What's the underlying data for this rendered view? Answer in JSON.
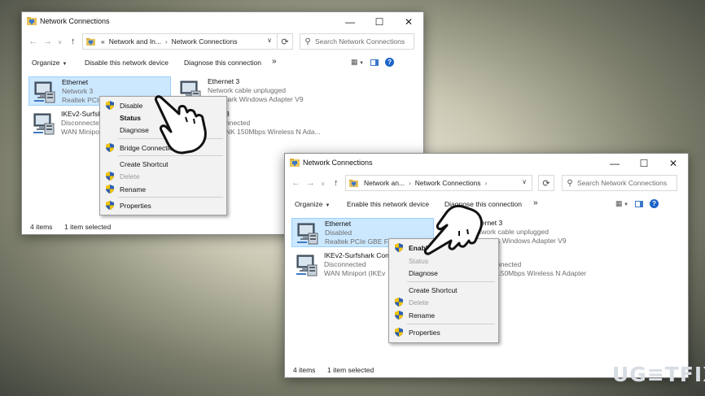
{
  "window1": {
    "title": "Network Connections",
    "controls": {
      "minimize": "—",
      "maximize": "☐",
      "close": "✕"
    },
    "address": {
      "overflow": "«",
      "crumbs": [
        "Network and In...",
        "Network Connections"
      ]
    },
    "search_placeholder": "Search Network Connections",
    "toolbar": {
      "organize": "Organize",
      "action1": "Disable this network device",
      "action2": "Diagnose this connection",
      "more": "»"
    },
    "items": [
      {
        "name": "Ethernet",
        "line2": "Network 3",
        "line3": "Realtek PCIe",
        "selected": true
      },
      {
        "name": "Ethernet 3",
        "line2": "Network cable unplugged",
        "line3": "Surfshark Windows Adapter V9",
        "selected": false
      },
      {
        "name": "IKEv2-Surfshark",
        "line2": "Disconnected",
        "line3": "WAN Miniport",
        "selected": false
      },
      {
        "name": "3",
        "line2": "nnected",
        "line3": "NK 150Mbps Wireless N Ada...",
        "selected": false
      }
    ],
    "context_menu": [
      {
        "label": "Disable",
        "shield": true,
        "bold": false,
        "disabled": false
      },
      {
        "label": "Status",
        "shield": false,
        "bold": true,
        "disabled": false
      },
      {
        "label": "Diagnose",
        "shield": false,
        "bold": false,
        "disabled": false
      },
      {
        "label": "Bridge Connections",
        "shield": true,
        "bold": false,
        "disabled": false
      },
      {
        "label": "Create Shortcut",
        "shield": false,
        "bold": false,
        "disabled": false
      },
      {
        "label": "Delete",
        "shield": true,
        "bold": false,
        "disabled": true
      },
      {
        "label": "Rename",
        "shield": true,
        "bold": false,
        "disabled": false
      },
      {
        "label": "Properties",
        "shield": true,
        "bold": false,
        "disabled": false
      }
    ],
    "status": {
      "count": "4 items",
      "selected": "1 item selected"
    }
  },
  "window2": {
    "title": "Network Connections",
    "controls": {
      "minimize": "—",
      "maximize": "☐",
      "close": "✕"
    },
    "address": {
      "crumbs": [
        "Network an...",
        "Network Connections"
      ],
      "trail": "›"
    },
    "search_placeholder": "Search Network Connections",
    "toolbar": {
      "organize": "Organize",
      "action1": "Enable this network device",
      "action2": "Diagnose this connection",
      "more": "»"
    },
    "items": [
      {
        "name": "Ethernet",
        "line2": "Disabled",
        "line3": "Realtek PCIe GBE Fam",
        "selected": true
      },
      {
        "name": "Ethernet 3",
        "line2": "Network cable unplugged",
        "line3": "Surfshark Windows Adapter V9",
        "selected": false
      },
      {
        "name": "IKEv2-Surfshark Conn",
        "line2": "Disconnected",
        "line3": "WAN Miniport (IKEv",
        "selected": false
      },
      {
        "name": "",
        "line2": "nnected",
        "line3": "150Mbps Wireless N Adapter",
        "selected": false
      }
    ],
    "context_menu": [
      {
        "label": "Enable",
        "shield": true,
        "bold": true,
        "disabled": false
      },
      {
        "label": "Status",
        "shield": false,
        "bold": false,
        "disabled": true
      },
      {
        "label": "Diagnose",
        "shield": false,
        "bold": false,
        "disabled": false
      },
      {
        "label": "Create Shortcut",
        "shield": false,
        "bold": false,
        "disabled": false
      },
      {
        "label": "Delete",
        "shield": true,
        "bold": false,
        "disabled": true
      },
      {
        "label": "Rename",
        "shield": true,
        "bold": false,
        "disabled": false
      },
      {
        "label": "Properties",
        "shield": true,
        "bold": false,
        "disabled": false
      }
    ],
    "status": {
      "count": "4 items",
      "selected": "1 item selected"
    }
  },
  "watermark": "UG≡TFIX",
  "colors": {
    "selection_fill": "#cce8ff",
    "selection_border": "#99d1ff",
    "help_blue": "#1c63c8",
    "menu_bg": "#f2f2f2"
  }
}
